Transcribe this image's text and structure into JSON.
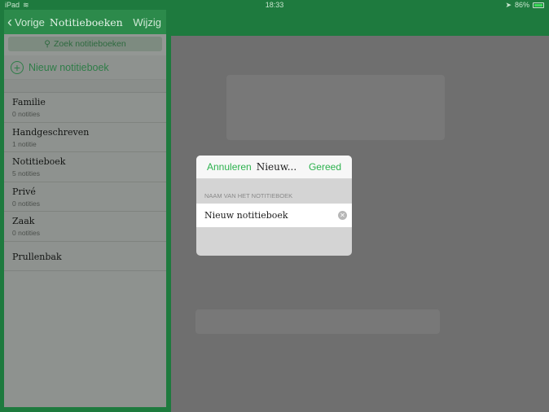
{
  "status": {
    "device": "iPad",
    "time": "18:33",
    "battery": "86%",
    "battery_level": 0.86
  },
  "sidebar": {
    "back_label": "Vorige",
    "title": "Notitieboeken",
    "edit_label": "Wijzig",
    "search_placeholder": "Zoek notitieboeken",
    "new_notebook_label": "Nieuw notitieboek",
    "notebooks": [
      {
        "name": "Familie",
        "count": "0 notities"
      },
      {
        "name": "Handgeschreven",
        "count": "1 notitie"
      },
      {
        "name": "Notitieboek",
        "count": "5 notities"
      },
      {
        "name": "Privé",
        "count": "0 notities"
      },
      {
        "name": "Zaak",
        "count": "0 notities"
      }
    ],
    "trash_label": "Prullenbak"
  },
  "modal": {
    "cancel_label": "Annuleren",
    "title": "Nieuw...",
    "done_label": "Gereed",
    "section_label": "NAAM VAN HET NOTITIEBOEK",
    "input_value": "Nieuw notitieboek"
  },
  "colors": {
    "accent": "#2db24e",
    "header_green": "#1e7a3e"
  }
}
